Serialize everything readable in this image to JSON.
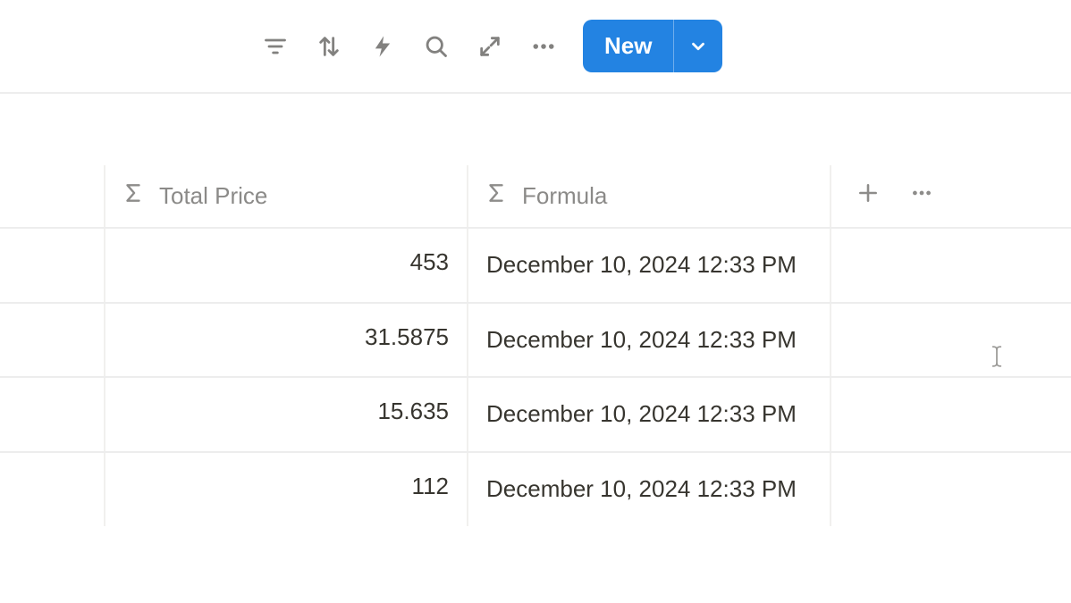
{
  "toolbar": {
    "new_label": "New"
  },
  "columns": {
    "total_price": {
      "label": "Total Price"
    },
    "formula": {
      "label": "Formula"
    }
  },
  "rows": [
    {
      "price": "453",
      "formula": "December 10, 2024 12:33 PM"
    },
    {
      "price": "31.5875",
      "formula": "December 10, 2024 12:33 PM"
    },
    {
      "price": "15.635",
      "formula": "December 10, 2024 12:33 PM"
    },
    {
      "price": "112",
      "formula": "December 10, 2024 12:33 PM"
    }
  ]
}
